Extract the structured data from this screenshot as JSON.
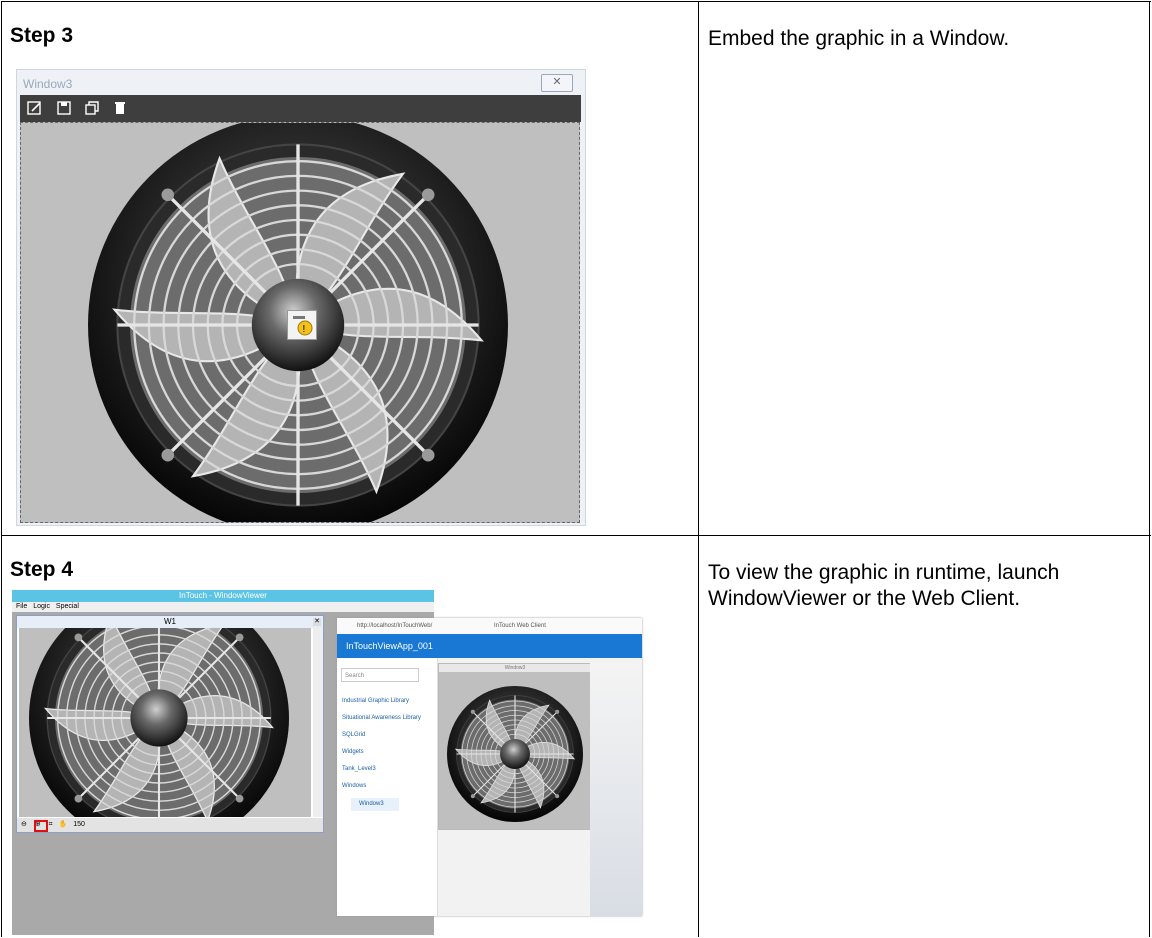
{
  "step3": {
    "title": "Step 3",
    "description": "Embed the graphic in a Window.",
    "window": {
      "title": "Window3",
      "toolbar_icons": [
        "edit-icon",
        "save-icon",
        "restore-icon",
        "delete-icon"
      ]
    }
  },
  "step4": {
    "title": "Step 4",
    "description": "To view the graphic in runtime, launch WindowViewer or the Web Client.",
    "windowviewer": {
      "title": "InTouch - WindowViewer",
      "menu": [
        "File",
        "Logic",
        "Special"
      ],
      "inner_window_title": "W1",
      "zoom_value": "150"
    },
    "webclient": {
      "url": "http://localhost/InTouchWeb/",
      "tab_title": "InTouch Web Client",
      "app_name": "InTouchViewApp_001",
      "search_placeholder": "Search",
      "nav": [
        "Industrial Graphic Library",
        "Situational Awareness Library",
        "SQLGrid",
        "Widgets",
        "Tank_Level3",
        "Windows"
      ],
      "selected_window": "Window3",
      "window_title": "Window3"
    }
  },
  "colors": {
    "toolbar": "#3e3e3e",
    "canvas": "#bfbfbf",
    "title_bar": "#5bc4e4",
    "web_header": "#1978d3",
    "zoom_highlight": "#e01010"
  }
}
